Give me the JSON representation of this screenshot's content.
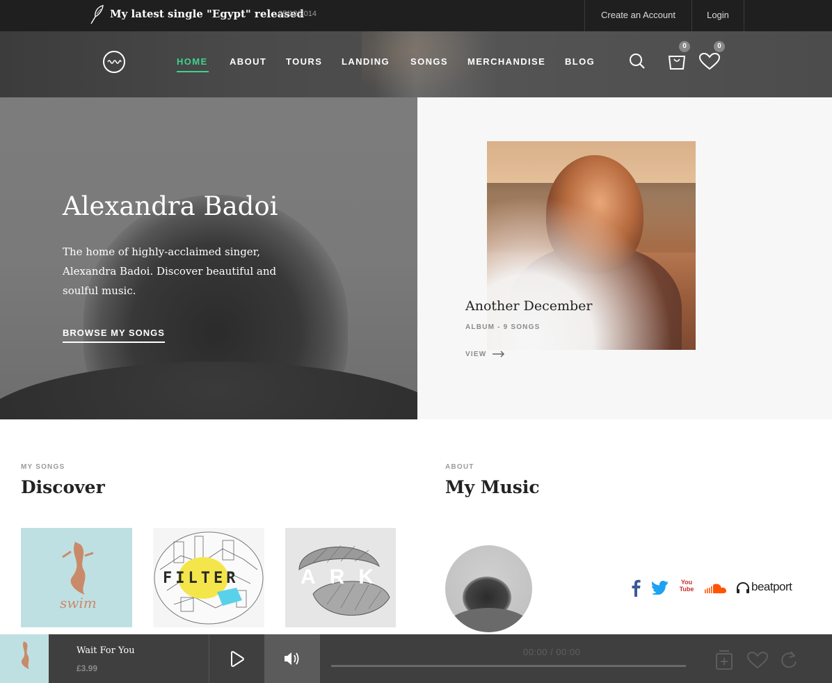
{
  "topbar": {
    "news_text": "My latest single \"Egypt\" released",
    "news_date": "05/12/2014",
    "create_account": "Create an Account",
    "login": "Login"
  },
  "nav": {
    "items": [
      {
        "label": "HOME",
        "active": true
      },
      {
        "label": "ABOUT",
        "active": false
      },
      {
        "label": "TOURS",
        "active": false
      },
      {
        "label": "LANDING",
        "active": false
      },
      {
        "label": "SONGS",
        "active": false
      },
      {
        "label": "MERCHANDISE",
        "active": false
      },
      {
        "label": "BLOG",
        "active": false
      }
    ],
    "cart_count": "0",
    "wishlist_count": "0",
    "accent_color": "#3ed28d"
  },
  "hero": {
    "title": "Alexandra Badoi",
    "description": "The home of highly-acclaimed singer, Alexandra Badoi. Discover beautiful and soulful music.",
    "cta": "BROWSE MY SONGS"
  },
  "featured_album": {
    "title": "Another December",
    "meta": "ALBUM - 9 SONGS",
    "view": "VIEW"
  },
  "songs_section": {
    "kicker": "MY SONGS",
    "title": "Discover",
    "covers": [
      {
        "name": "swim",
        "text": "swim"
      },
      {
        "name": "filter",
        "text": "FILTER"
      },
      {
        "name": "ark",
        "text": "ARK"
      }
    ]
  },
  "about_section": {
    "kicker": "ABOUT",
    "title": "My Music",
    "social": [
      "facebook",
      "twitter",
      "youtube",
      "soundcloud",
      "beatport"
    ],
    "youtube_text": "You Tube",
    "beatport_text": "beatport"
  },
  "player": {
    "track_title": "Wait For You",
    "price": "£3.99",
    "time": "00:00 / 00:00",
    "progress": 0
  }
}
